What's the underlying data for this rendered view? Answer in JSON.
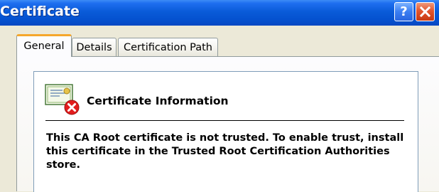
{
  "window": {
    "title": "Certificate",
    "help_label": "?",
    "colors": {
      "titlebar": "#0552d0",
      "close": "#e2542c",
      "help": "#3a7ef2",
      "tab_highlight": "#f5a72c",
      "background": "#ece9d8"
    }
  },
  "tabs": [
    {
      "label": "General",
      "active": true
    },
    {
      "label": "Details",
      "active": false
    },
    {
      "label": "Certification Path",
      "active": false
    }
  ],
  "info": {
    "icon": "certificate-error-icon",
    "title": "Certificate Information",
    "message": "This CA Root certificate is not trusted. To enable trust, install this certificate in the Trusted Root Certification Authorities store."
  }
}
